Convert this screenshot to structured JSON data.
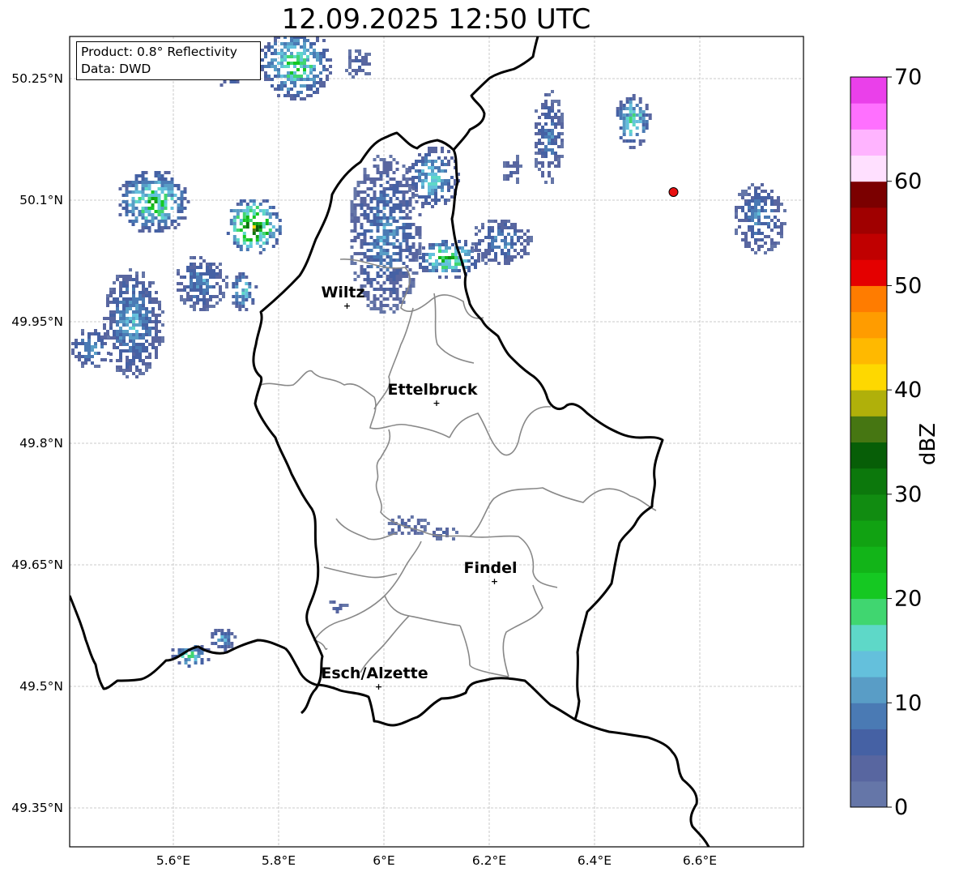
{
  "title": "12.09.2025 12:50 UTC",
  "info_box": {
    "line1": "Product: 0.8° Reflectivity",
    "line2": "Data: DWD"
  },
  "map_extent": {
    "lon": [
      5.4,
      6.8
    ],
    "lat": [
      49.28,
      50.32
    ]
  },
  "lon_ticks": [
    {
      "value": 5.6,
      "label": "5.6°E"
    },
    {
      "value": 5.8,
      "label": "5.8°E"
    },
    {
      "value": 6.0,
      "label": "6°E"
    },
    {
      "value": 6.2,
      "label": "6.2°E"
    },
    {
      "value": 6.4,
      "label": "6.4°E"
    },
    {
      "value": 6.6,
      "label": "6.6°E"
    }
  ],
  "lat_ticks": [
    {
      "value": 50.25,
      "label": "50.25°N"
    },
    {
      "value": 50.1,
      "label": "50.1°N"
    },
    {
      "value": 49.95,
      "label": "49.95°N"
    },
    {
      "value": 49.8,
      "label": "49.8°N"
    },
    {
      "value": 49.65,
      "label": "49.65°N"
    },
    {
      "value": 49.5,
      "label": "49.5°N"
    },
    {
      "value": 49.35,
      "label": "49.35°N"
    }
  ],
  "cities": [
    {
      "name": "Wiltz",
      "lon": 5.93,
      "lat": 49.97
    },
    {
      "name": "Ettelbruck",
      "lon": 6.1,
      "lat": 49.85
    },
    {
      "name": "Findel",
      "lon": 6.21,
      "lat": 49.63
    },
    {
      "name": "Esch/Alzette",
      "lon": 5.99,
      "lat": 49.5
    }
  ],
  "radar_site": {
    "lon": 6.55,
    "lat": 50.11,
    "color": "#e81010"
  },
  "colorbar": {
    "label": "dBZ",
    "min": 0,
    "max": 70,
    "step": 2.5,
    "tick_labels": [
      "0",
      "10",
      "20",
      "30",
      "40",
      "50",
      "60",
      "70"
    ],
    "colors": [
      "#6576a8",
      "#5866a0",
      "#4561a4",
      "#4a7ab4",
      "#599dc6",
      "#64c0dc",
      "#5ed8c8",
      "#40d670",
      "#15c822",
      "#12b418",
      "#11a212",
      "#118c11",
      "#0c780c",
      "#075e07",
      "#467612",
      "#b0b00a",
      "#fed800",
      "#ffb900",
      "#ff9c00",
      "#ff7c00",
      "#e40000",
      "#c00000",
      "#a00000",
      "#7b0000",
      "#ffe0ff",
      "#ffb4ff",
      "#ff70ff",
      "#ea40ea"
    ]
  },
  "echoes": [
    {
      "lon": 5.83,
      "lat": 50.27,
      "rx": 0.07,
      "ry": 0.045,
      "max": 26
    },
    {
      "lon": 5.7,
      "lat": 50.26,
      "rx": 0.03,
      "ry": 0.02,
      "max": 18
    },
    {
      "lon": 5.95,
      "lat": 50.27,
      "rx": 0.03,
      "ry": 0.02,
      "max": 8
    },
    {
      "lon": 5.56,
      "lat": 50.1,
      "rx": 0.07,
      "ry": 0.04,
      "max": 28
    },
    {
      "lon": 5.75,
      "lat": 50.07,
      "rx": 0.055,
      "ry": 0.035,
      "max": 40
    },
    {
      "lon": 5.65,
      "lat": 50.0,
      "rx": 0.05,
      "ry": 0.035,
      "max": 14
    },
    {
      "lon": 5.73,
      "lat": 49.99,
      "rx": 0.025,
      "ry": 0.025,
      "max": 20
    },
    {
      "lon": 5.52,
      "lat": 49.95,
      "rx": 0.06,
      "ry": 0.07,
      "max": 16
    },
    {
      "lon": 5.44,
      "lat": 49.92,
      "rx": 0.04,
      "ry": 0.025,
      "max": 16
    },
    {
      "lon": 6.0,
      "lat": 50.06,
      "rx": 0.07,
      "ry": 0.1,
      "max": 14
    },
    {
      "lon": 6.09,
      "lat": 50.13,
      "rx": 0.05,
      "ry": 0.04,
      "max": 20
    },
    {
      "lon": 6.12,
      "lat": 50.03,
      "rx": 0.06,
      "ry": 0.025,
      "max": 30
    },
    {
      "lon": 6.22,
      "lat": 50.05,
      "rx": 0.06,
      "ry": 0.03,
      "max": 14
    },
    {
      "lon": 6.31,
      "lat": 50.18,
      "rx": 0.03,
      "ry": 0.06,
      "max": 12
    },
    {
      "lon": 6.24,
      "lat": 50.14,
      "rx": 0.02,
      "ry": 0.02,
      "max": 8
    },
    {
      "lon": 6.47,
      "lat": 50.2,
      "rx": 0.035,
      "ry": 0.035,
      "max": 24
    },
    {
      "lon": 6.71,
      "lat": 50.08,
      "rx": 0.05,
      "ry": 0.045,
      "max": 14
    },
    {
      "lon": 6.04,
      "lat": 49.7,
      "rx": 0.045,
      "ry": 0.015,
      "max": 8
    },
    {
      "lon": 6.11,
      "lat": 49.69,
      "rx": 0.03,
      "ry": 0.01,
      "max": 8
    },
    {
      "lon": 5.63,
      "lat": 49.54,
      "rx": 0.04,
      "ry": 0.015,
      "max": 22
    },
    {
      "lon": 5.69,
      "lat": 49.56,
      "rx": 0.025,
      "ry": 0.015,
      "max": 16
    },
    {
      "lon": 5.91,
      "lat": 49.6,
      "rx": 0.02,
      "ry": 0.01,
      "max": 8
    }
  ]
}
